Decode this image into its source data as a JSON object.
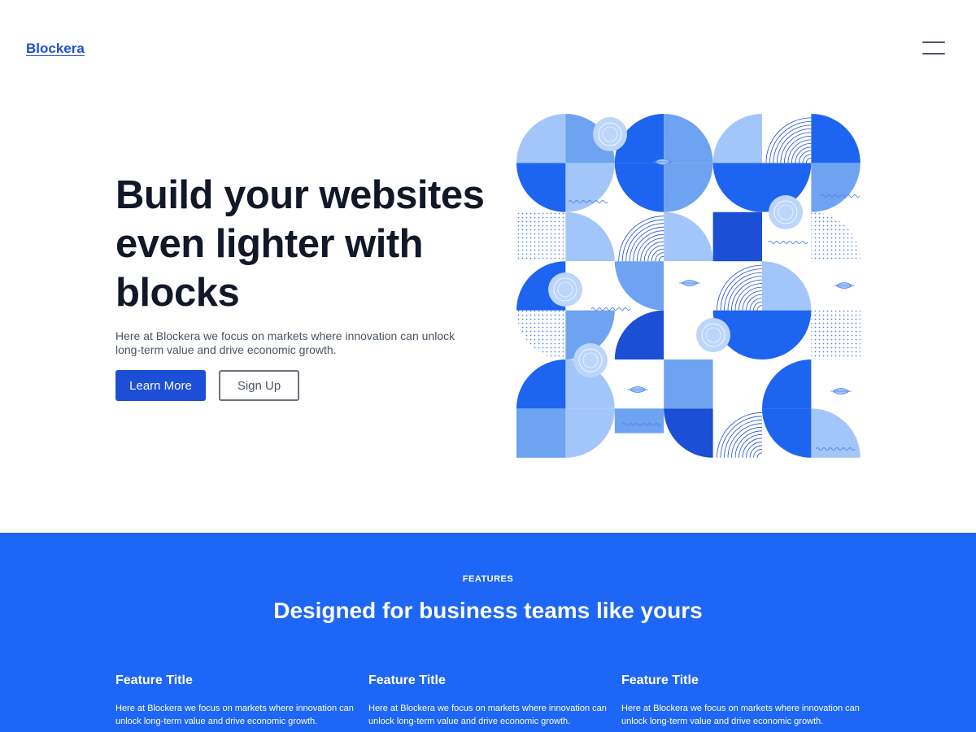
{
  "header": {
    "logo": "Blockera",
    "menu_icon": "hamburger-menu-icon"
  },
  "hero": {
    "title": "Build your websites even lighter with blocks",
    "subtitle": "Here at Blockera we focus on markets where innovation can unlock long-term value and drive economic growth.",
    "primary_button": "Learn More",
    "secondary_button": "Sign Up"
  },
  "colors": {
    "brand": "#1d4ed8",
    "features_bg": "#1e66f5",
    "pattern_light": "#a3c6fa",
    "pattern_mid": "#6ea3f2",
    "pattern_dark": "#1d64f0",
    "pattern_deep": "#1a4fd6"
  },
  "features": {
    "eyebrow": "FEATURES",
    "heading": "Designed for business teams like yours",
    "items": [
      {
        "title": "Feature Title",
        "description": "Here at Blockera we focus on markets where innovation can unlock long-term value and drive economic growth."
      },
      {
        "title": "Feature Title",
        "description": "Here at Blockera we focus on markets where innovation can unlock long-term value and drive economic growth."
      },
      {
        "title": "Feature Title",
        "description": "Here at Blockera we focus on markets where innovation can unlock long-term value and drive economic growth."
      }
    ]
  }
}
